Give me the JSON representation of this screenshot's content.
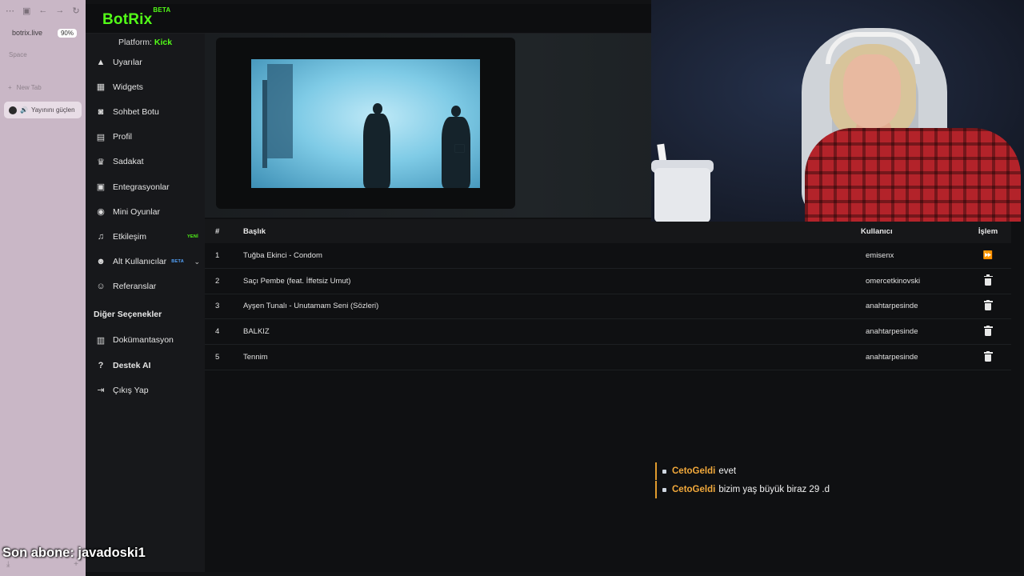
{
  "browser": {
    "url": "botrix.live",
    "zoom": "90%",
    "space_label": "Space",
    "new_tab_label": "New Tab",
    "active_tab_title": "Yayınını güçlen"
  },
  "app": {
    "logo": "BotRix",
    "logo_badge": "BETA",
    "platform_label": "Platform:",
    "platform_value": "Kick"
  },
  "sidebar": {
    "items": [
      {
        "label": "Uyarılar",
        "icon": "warning-icon"
      },
      {
        "label": "Widgets",
        "icon": "grid-icon"
      },
      {
        "label": "Sohbet Botu",
        "icon": "robot-icon"
      },
      {
        "label": "Profil",
        "icon": "id-card-icon"
      },
      {
        "label": "Sadakat",
        "icon": "trophy-icon"
      },
      {
        "label": "Entegrasyonlar",
        "icon": "plug-icon"
      },
      {
        "label": "Mini Oyunlar",
        "icon": "gamepad-icon"
      },
      {
        "label": "Etkileşim",
        "icon": "music-icon",
        "badge": "YENİ"
      },
      {
        "label": "Alt Kullanıcılar",
        "icon": "users-icon",
        "badge": "BETA"
      },
      {
        "label": "Referanslar",
        "icon": "user-group-icon"
      }
    ],
    "other_heading": "Diğer Seçenekler",
    "other_items": [
      {
        "label": "Dokümantasyon",
        "icon": "book-icon"
      },
      {
        "label": "Destek AI",
        "icon": "question-icon"
      },
      {
        "label": "Çıkış Yap",
        "icon": "logout-icon"
      }
    ]
  },
  "queue": {
    "headers": {
      "num": "#",
      "title": "Başlık",
      "user": "Kullanıcı",
      "action": "İşlem"
    },
    "rows": [
      {
        "num": "1",
        "title": "Tuğba Ekinci - Condom",
        "user": "emisenx",
        "action": "skip-icon"
      },
      {
        "num": "2",
        "title": "Saçı Pembe (feat. İffetsiz Umut)",
        "user": "omercetkinovski",
        "action": "trash-icon"
      },
      {
        "num": "3",
        "title": "Ayşen Tunalı - Unutamam Seni (Sözleri)",
        "user": "anahtarpesinde",
        "action": "trash-icon"
      },
      {
        "num": "4",
        "title": "BALKIZ",
        "user": "anahtarpesinde",
        "action": "trash-icon"
      },
      {
        "num": "5",
        "title": "Tennim",
        "user": "anahtarpesinde",
        "action": "trash-icon"
      }
    ]
  },
  "chat": {
    "messages": [
      {
        "user": "CetoGeldi",
        "text": "evet"
      },
      {
        "user": "CetoGeldi",
        "text": "bizim yaş büyük biraz 29 .d"
      }
    ]
  },
  "overlay": {
    "last_sub": "Son abone: javadoski1"
  },
  "colors": {
    "accent": "#53fc18",
    "chat_user": "#f2a93b",
    "beta": "#53a3fc"
  }
}
